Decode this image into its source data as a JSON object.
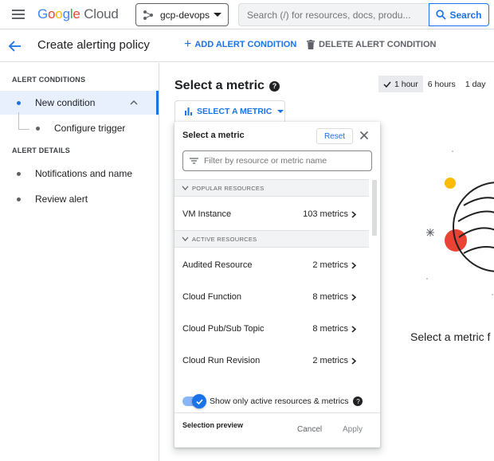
{
  "header": {
    "logo_google": "Google",
    "logo_cloud": "Cloud",
    "project": "gcp-devops",
    "search_placeholder": "Search (/) for resources, docs, produ...",
    "search_button": "Search"
  },
  "subheader": {
    "title": "Create alerting policy",
    "add_condition": "ADD ALERT CONDITION",
    "delete_condition": "DELETE ALERT CONDITION"
  },
  "sidebar": {
    "conditions_label": "ALERT CONDITIONS",
    "new_condition": "New condition",
    "configure_trigger": "Configure trigger",
    "details_label": "ALERT DETAILS",
    "notifications": "Notifications and name",
    "review": "Review alert"
  },
  "main": {
    "title": "Select a metric",
    "time_options": [
      "1 hour",
      "6 hours",
      "1 day"
    ],
    "selected_time": "1 hour",
    "select_metric_button": "SELECT A METRIC",
    "empty_state_text": "Select a metric f"
  },
  "metric_panel": {
    "title": "Select a metric",
    "reset": "Reset",
    "filter_placeholder": "Filter by resource or metric name",
    "popular_header": "POPULAR RESOURCES",
    "popular": [
      {
        "name": "VM Instance",
        "count": "103 metrics"
      }
    ],
    "active_header": "ACTIVE RESOURCES",
    "active": [
      {
        "name": "Audited Resource",
        "count": "2 metrics"
      },
      {
        "name": "Cloud Function",
        "count": "8 metrics"
      },
      {
        "name": "Cloud Pub/Sub Topic",
        "count": "8 metrics"
      },
      {
        "name": "Cloud Run Revision",
        "count": "2 metrics"
      }
    ],
    "toggle_label": "Show only active resources & metrics",
    "toggle_on": true,
    "selection_preview": "Selection preview",
    "cancel": "Cancel",
    "apply": "Apply"
  },
  "colors": {
    "accent": "#1a73e8",
    "google_blue": "#4285f4",
    "google_red": "#ea4335",
    "google_yellow": "#fbbc04",
    "google_green": "#34a853"
  }
}
